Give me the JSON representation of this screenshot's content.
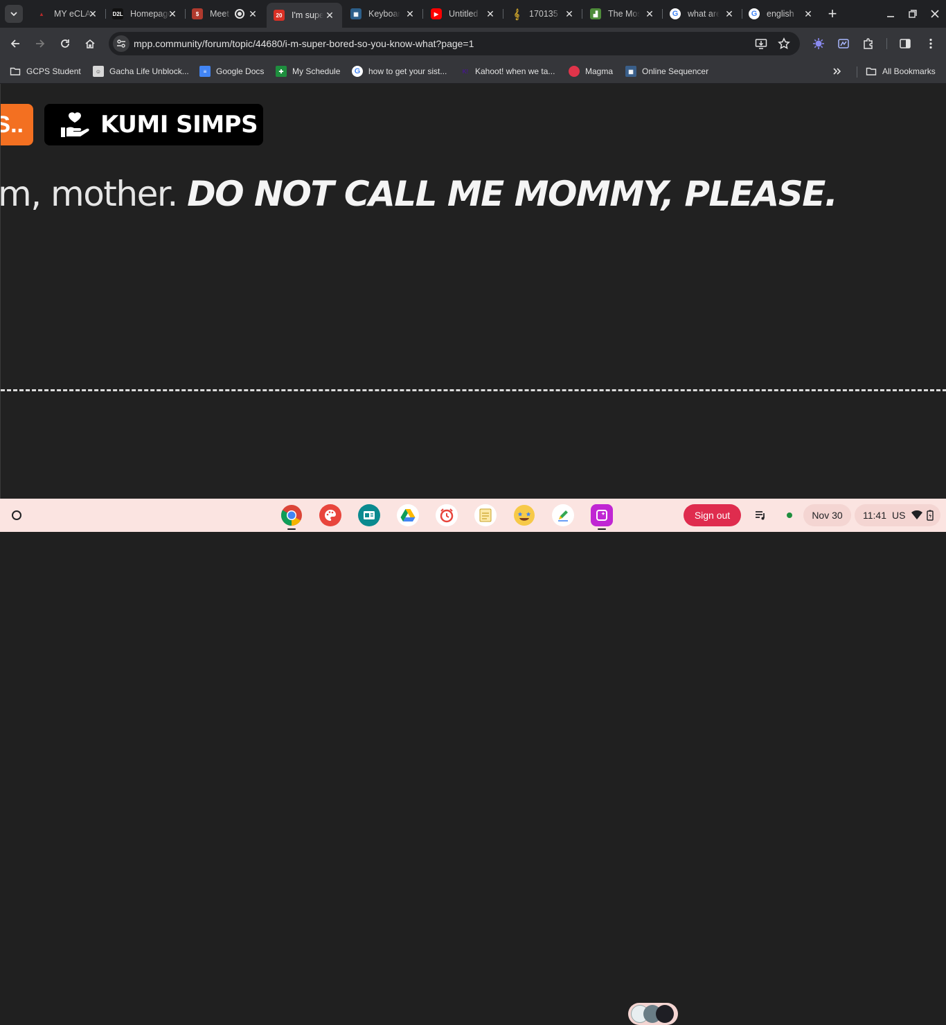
{
  "tabs": [
    {
      "title": "MY eCLASS",
      "favicon_color": "#7a1b1b",
      "favicon_glyph": "▲"
    },
    {
      "title": "Homepage",
      "favicon_color": "#111111",
      "favicon_glyph": "D2L"
    },
    {
      "title": "Meet",
      "favicon_color": "#b03a2e",
      "favicon_glyph": "$"
    },
    {
      "title": "I'm super bored",
      "favicon_color": "#d93025",
      "favicon_glyph": "20",
      "active": true
    },
    {
      "title": "Keyboard",
      "favicon_color": "#2c5f8a",
      "favicon_glyph": "▦"
    },
    {
      "title": "Untitled",
      "favicon_color": "#ff0000",
      "favicon_glyph": "▶"
    },
    {
      "title": "170135",
      "favicon_color": "#c8a02a",
      "favicon_glyph": "𝄞"
    },
    {
      "title": "The Most",
      "favicon_color": "#4e8c3a",
      "favicon_glyph": "▟"
    },
    {
      "title": "what are",
      "favicon_color": "#ffffff",
      "favicon_glyph": "G"
    },
    {
      "title": "english",
      "favicon_color": "#ffffff",
      "favicon_glyph": "G"
    }
  ],
  "toolbar": {
    "url": "mpp.community/forum/topic/44680/i-m-super-bored-so-you-know-what?page=1"
  },
  "bookmarks": [
    {
      "label": "GCPS Student",
      "icon": "folder-icon"
    },
    {
      "label": "Gacha Life Unblock...",
      "icon": "gacha-icon"
    },
    {
      "label": "Google Docs",
      "icon": "docs-icon"
    },
    {
      "label": "My Schedule",
      "icon": "schedule-icon"
    },
    {
      "label": "how to get your sist...",
      "icon": "google-icon"
    },
    {
      "label": "Kahoot! when we ta...",
      "icon": "kahoot-icon"
    },
    {
      "label": "Magma",
      "icon": "magma-icon"
    },
    {
      "label": "Online Sequencer",
      "icon": "sequencer-icon"
    }
  ],
  "bookmarks_all": "All Bookmarks",
  "page": {
    "orange_badge": "S..",
    "badge_name": "KUMI SIMPS",
    "post_plain": "m, mother. ",
    "post_emphasis": "DO NOT CALL ME MOMMY, PLEASE."
  },
  "shelf": {
    "signout": "Sign out",
    "date": "Nov 30",
    "time": "11:41",
    "locale": "US"
  }
}
